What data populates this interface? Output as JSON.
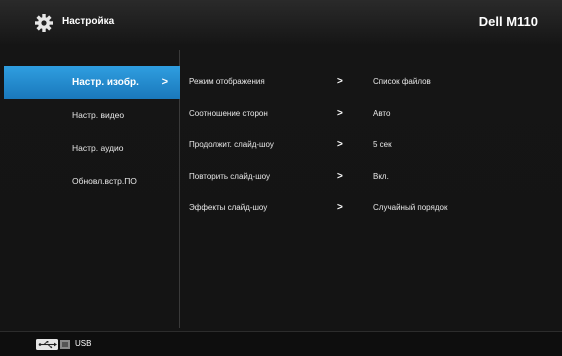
{
  "header": {
    "title": "Настройка",
    "model": "Dell M110",
    "icon": "gear-icon"
  },
  "left_menu": {
    "items": [
      {
        "label": "Настр. изобр.",
        "active": true,
        "chevron": ">"
      },
      {
        "label": "Настр. видео",
        "active": false
      },
      {
        "label": "Настр. аудио",
        "active": false
      },
      {
        "label": "Обновл.встр.ПО",
        "active": false
      }
    ]
  },
  "settings": {
    "arrow": ">",
    "rows": [
      {
        "label": "Режим отображения",
        "value": "Список файлов"
      },
      {
        "label": "Соотношение сторон",
        "value": "Авто"
      },
      {
        "label": "Продолжит. слайд-шоу",
        "value": "5 сек"
      },
      {
        "label": "Повторить слайд-шоу",
        "value": "Вкл."
      },
      {
        "label": "Эффекты слайд-шоу",
        "value": "Случайный порядок"
      }
    ]
  },
  "footer": {
    "source_label": "USB",
    "icon": "usb-icon"
  },
  "colors": {
    "accent": "#2288cc",
    "background": "#151515"
  }
}
